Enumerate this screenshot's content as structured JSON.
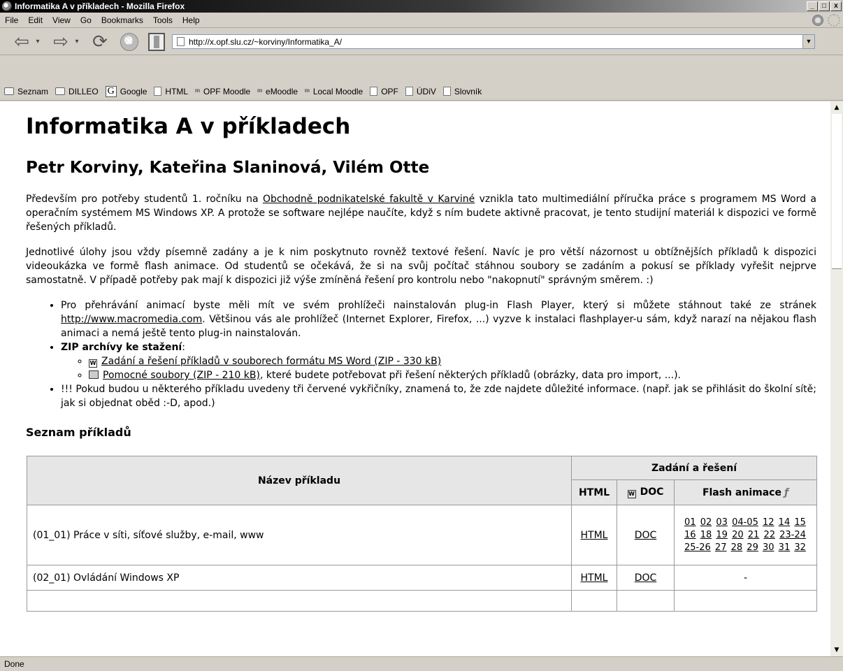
{
  "window": {
    "title": "Informatika A v příkladech - Mozilla Firefox",
    "buttons": {
      "minimize": "_",
      "maximize": "□",
      "close": "x"
    }
  },
  "menu": [
    "File",
    "Edit",
    "View",
    "Go",
    "Bookmarks",
    "Tools",
    "Help"
  ],
  "nav": {
    "url": "http://x.opf.slu.cz/~korviny/Informatika_A/"
  },
  "bookmarks": [
    {
      "label": "Seznam",
      "icon": "folder-icon"
    },
    {
      "label": "DILLEO",
      "icon": "folder-icon"
    },
    {
      "label": "Google",
      "icon": "google-icon"
    },
    {
      "label": "HTML",
      "icon": "page-icon"
    },
    {
      "label": "OPF Moodle",
      "icon": "moodle-icon"
    },
    {
      "label": "eMoodle",
      "icon": "moodle-icon"
    },
    {
      "label": "Local Moodle",
      "icon": "moodle-icon"
    },
    {
      "label": "OPF",
      "icon": "page-icon"
    },
    {
      "label": "ÚDiV",
      "icon": "page-icon"
    },
    {
      "label": "Slovník",
      "icon": "page-icon"
    }
  ],
  "page": {
    "h1": "Informatika A v příkladech",
    "authors": "Petr Korviny, Kateřina Slaninová, Vilém Otte",
    "p1": {
      "before": "Především pro potřeby studentů 1. ročníku na ",
      "link": "Obchodně podnikatelské fakultě v Karviné",
      "after": " vznikla tato multimediální příručka práce s programem MS Word a operačním systémem MS Windows XP. A protože se software nejlépe naučíte, když s ním budete aktivně pracovat, je tento studijní materiál k dispozici ve formě řešených příkladů."
    },
    "p2": "Jednotlivé úlohy jsou vždy písemně zadány a je k nim poskytnuto rovněž textové řešení. Navíc je pro větší názornost u obtížnějších příkladů k dispozici videoukázka ve formě flash animace. Od studentů se očekává, že si na svůj počítač stáhnou soubory se zadáním a pokusí se příklady vyřešit nejprve samostatně. V případě potřeby pak mají k dispozici již výše zmíněná řešení pro kontrolu nebo \"nakopnutí\" správným směrem. :)",
    "bullet1": {
      "before": "Pro přehrávání animací byste měli mít ve svém prohlížeči nainstalován plug-in Flash Player, který si můžete stáhnout také ze stránek ",
      "link": "http://www.macromedia.com",
      "after": ". Většinou vás ale prohlížeč (Internet Explorer, Firefox, ...) vyzve k instalaci flashplayer-u sám, když narazí na nějakou flash animaci a nemá ještě tento plug-in nainstalován."
    },
    "bullet2_label": "ZIP archívy ke stažení",
    "bullet2_colon": ":",
    "zip1": "Zadání a řešení příkladů v souborech formátu MS Word (ZIP - 330 kB)",
    "zip2_link": "Pomocné soubory (ZIP - 210 kB)",
    "zip2_after": ", které budete potřebovat při řešení některých příkladů (obrázky, data pro import, ...).",
    "bullet3": "!!! Pokud budou u některého příkladu uvedeny tři červené vykřičníky, znamená to, že zde najdete důležité informace. (např. jak se přihlásit do školní sítě; jak si objednat oběd :-D, apod.)",
    "list_heading": "Seznam příkladů"
  },
  "table": {
    "col_name": "Název příkladu",
    "group": "Zadání a řešení",
    "col_html": "HTML",
    "col_doc": "DOC",
    "col_flash": "Flash animace",
    "rows": [
      {
        "name": "(01_01) Práce v síti, síťové služby, e-mail, www",
        "html": "HTML",
        "doc": "DOC",
        "flash": [
          "01",
          "02",
          "03",
          "04-05",
          "12",
          "14",
          "15",
          "16",
          "18",
          "19",
          "20",
          "21",
          "22",
          "23-24",
          "25-26",
          "27",
          "28",
          "29",
          "30",
          "31",
          "32"
        ]
      },
      {
        "name": "(02_01) Ovládání Windows XP",
        "html": "HTML",
        "doc": "DOC",
        "flash_none": "-"
      }
    ]
  },
  "status": "Done"
}
